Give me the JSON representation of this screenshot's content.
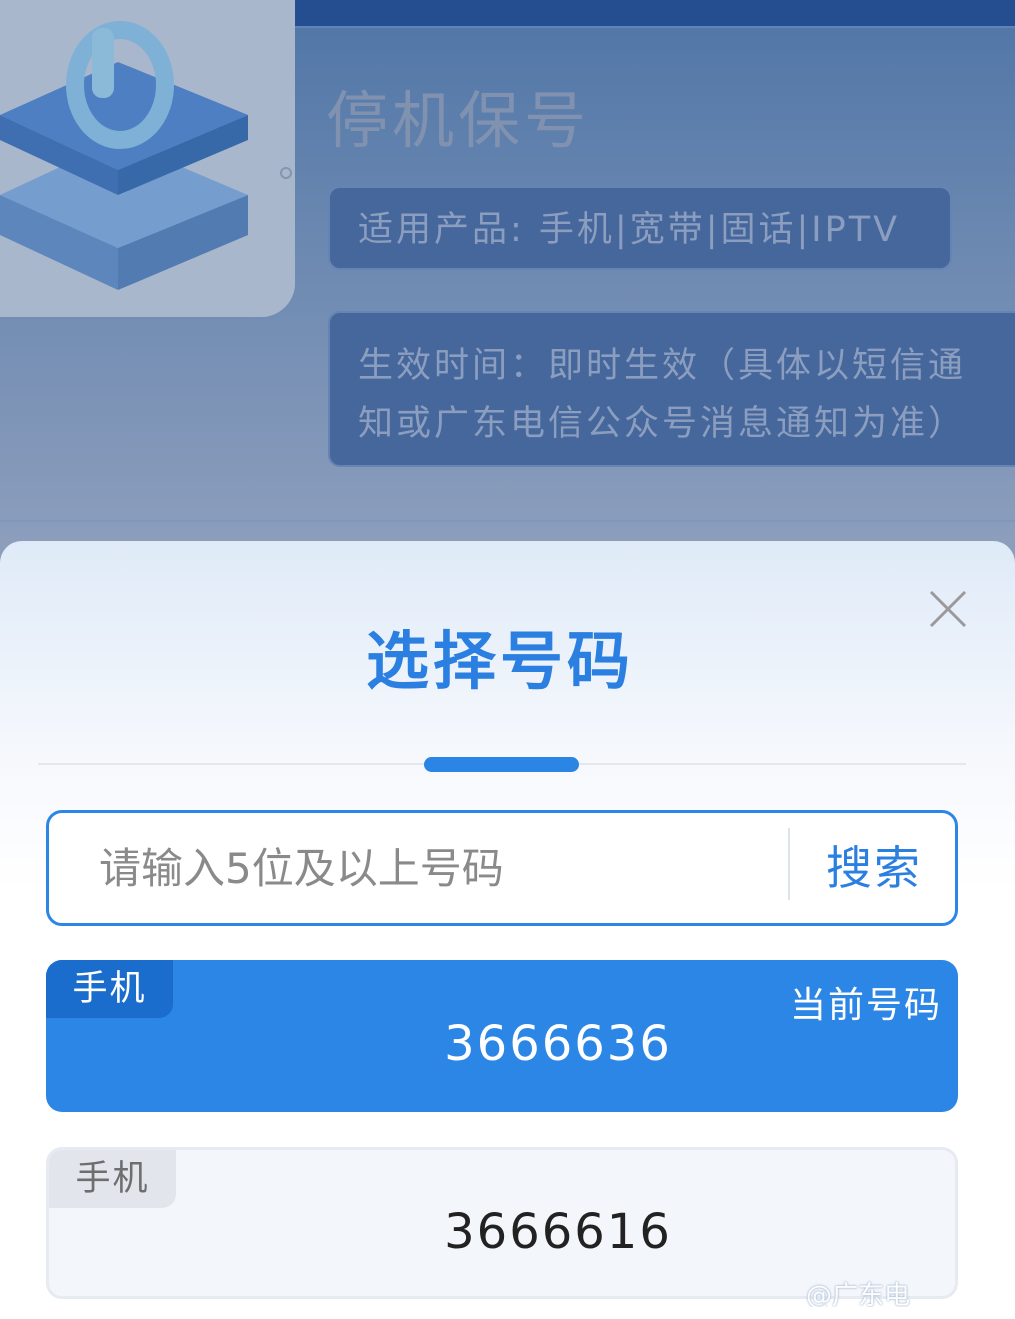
{
  "product": {
    "title": "停机保号",
    "applicable": "适用产品: 手机|宽带|固话|IPTV",
    "effective_line1": "生效时间：即时生效（具体以短信通",
    "effective_line2": "知或广东电信公众号消息通知为准）"
  },
  "sheet": {
    "title": "选择号码",
    "search": {
      "placeholder": "请输入5位及以上号码",
      "value": "",
      "button": "搜索"
    },
    "numbers": [
      {
        "tag": "手机",
        "number": "3666636",
        "current_label": "当前号码",
        "selected": true
      },
      {
        "tag": "手机",
        "number": "3666616",
        "selected": false
      }
    ]
  },
  "watermark": "@广东电",
  "colors": {
    "accent": "#2a85e4",
    "selected_tag": "#1a6dcc",
    "dim_background": "#5a7cab"
  }
}
